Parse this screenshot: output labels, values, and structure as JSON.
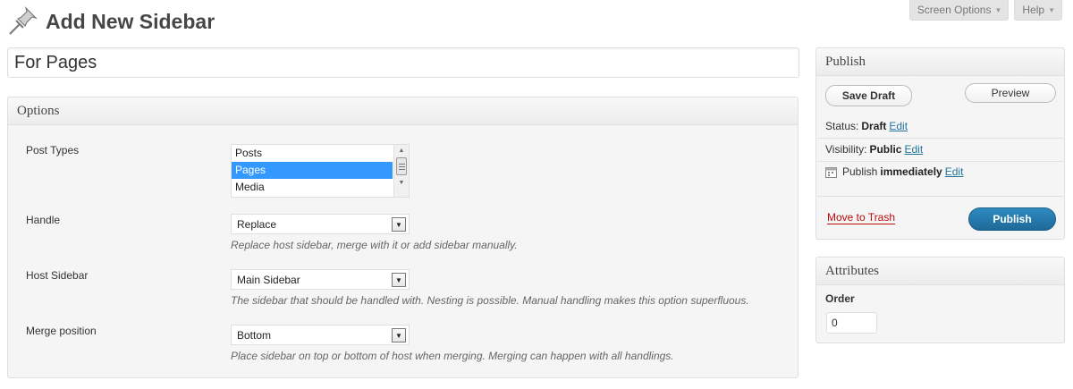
{
  "header": {
    "title": "Add New Sidebar",
    "icon": "pushpin-icon"
  },
  "screen_tabs": {
    "screen_options": "Screen Options",
    "help": "Help"
  },
  "post_title": {
    "value": "For Pages"
  },
  "options_box": {
    "title": "Options",
    "post_types": {
      "label": "Post Types",
      "items": [
        "Posts",
        "Pages",
        "Media"
      ],
      "selected": "Pages"
    },
    "handle": {
      "label": "Handle",
      "value": "Replace",
      "description": "Replace host sidebar, merge with it or add sidebar manually."
    },
    "host_sidebar": {
      "label": "Host Sidebar",
      "value": "Main Sidebar",
      "description": "The sidebar that should be handled with. Nesting is possible. Manual handling makes this option superfluous."
    },
    "merge_position": {
      "label": "Merge position",
      "value": "Bottom",
      "description": "Place sidebar on top or bottom of host when merging. Merging can happen with all handlings."
    }
  },
  "publish_box": {
    "title": "Publish",
    "save_draft": "Save Draft",
    "preview": "Preview",
    "status_label": "Status:",
    "status_value": "Draft",
    "visibility_label": "Visibility:",
    "visibility_value": "Public",
    "publish_label": "Publish",
    "publish_value": "immediately",
    "edit": "Edit",
    "move_to_trash": "Move to Trash",
    "publish_button": "Publish"
  },
  "attributes_box": {
    "title": "Attributes",
    "order_label": "Order",
    "order_value": "0"
  },
  "colors": {
    "link": "#21759b",
    "trash": "#bc0b0b",
    "publish_button": "#21759b",
    "selected_item": "#3399ff"
  }
}
